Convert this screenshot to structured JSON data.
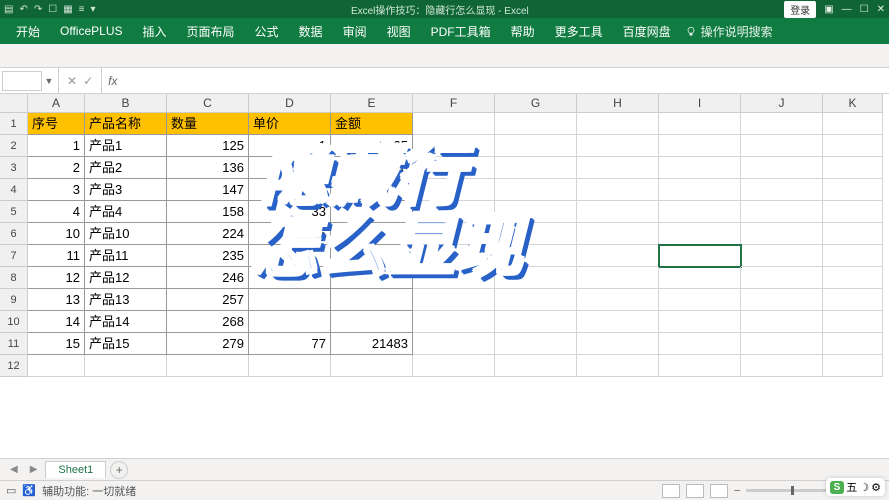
{
  "app": {
    "title": "Excel操作技巧：隐藏行怎么显现  -  Excel",
    "login": "登录"
  },
  "ribbon": {
    "tabs": [
      "开始",
      "OfficePLUS",
      "插入",
      "页面布局",
      "公式",
      "数据",
      "审阅",
      "视图",
      "PDF工具箱",
      "帮助",
      "更多工具",
      "百度网盘"
    ],
    "tellme": "操作说明搜索"
  },
  "formula": {
    "namebox": "",
    "fx": "fx"
  },
  "grid": {
    "columns": [
      "A",
      "B",
      "C",
      "D",
      "E",
      "F",
      "G",
      "H",
      "I",
      "J",
      "K"
    ],
    "headers": [
      "序号",
      "产品名称",
      "数量",
      "单价",
      "金额"
    ],
    "row_numbers": [
      1,
      2,
      3,
      4,
      5,
      6,
      7,
      8,
      9,
      10,
      11,
      12
    ],
    "rows": [
      {
        "序号": 1,
        "产品名称": "产品1",
        "数量": 125,
        "单价": 21,
        "金额": 2625
      },
      {
        "序号": 2,
        "产品名称": "产品2",
        "数量": 136,
        "单价": 25,
        "金额": 3400
      },
      {
        "序号": 3,
        "产品名称": "产品3",
        "数量": 147,
        "单价": 29,
        "金额": ""
      },
      {
        "序号": 4,
        "产品名称": "产品4",
        "数量": 158,
        "单价": 33,
        "金额": ""
      },
      {
        "序号": 10,
        "产品名称": "产品10",
        "数量": 224,
        "单价": 5,
        "金额": ""
      },
      {
        "序号": 11,
        "产品名称": "产品11",
        "数量": 235,
        "单价": "",
        "金额": ""
      },
      {
        "序号": 12,
        "产品名称": "产品12",
        "数量": 246,
        "单价": "",
        "金额": ""
      },
      {
        "序号": 13,
        "产品名称": "产品13",
        "数量": 257,
        "单价": "",
        "金额": ""
      },
      {
        "序号": 14,
        "产品名称": "产品14",
        "数量": 268,
        "单价": "",
        "金额": ""
      },
      {
        "序号": 15,
        "产品名称": "产品15",
        "数量": 279,
        "单价": 77,
        "金额": 21483
      }
    ],
    "selected_cell": "I7"
  },
  "sheet": {
    "tabs": [
      "Sheet1"
    ]
  },
  "status": {
    "ready": "",
    "accessibility": "辅助功能: 一切就绪",
    "zoom": "100%"
  },
  "overlay": {
    "line1": "隐藏行",
    "line2": "怎么显现"
  },
  "tray": {
    "ime": "五"
  }
}
